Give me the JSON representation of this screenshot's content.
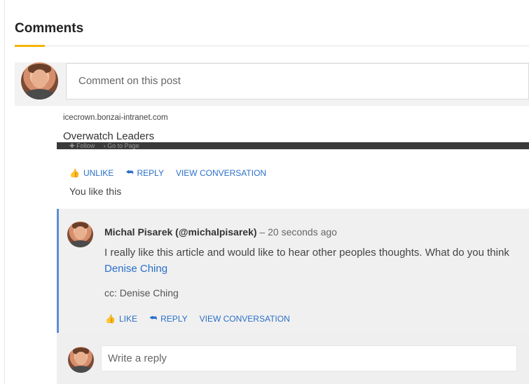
{
  "section": {
    "title": "Comments",
    "accent_color": "#f4b400"
  },
  "composer": {
    "placeholder": "Comment on this post",
    "avatar_icon": "user-avatar"
  },
  "link_preview": {
    "domain": "icecrown.bonzai-intranet.com",
    "title": "Overwatch Leaders",
    "follow_label": "Follow",
    "go_to_page_label": "Go to Page"
  },
  "post_actions": {
    "unlike_label": "UNLIKE",
    "reply_label": "REPLY",
    "view_conversation_label": "VIEW CONVERSATION",
    "like_status": "You like this",
    "link_color": "#2a6fc9"
  },
  "reply": {
    "author": "Michal Pisarek (@michalpisarek)",
    "separator": "–",
    "time": "20 seconds ago",
    "text": "I really like this article and would like to hear other peoples thoughts. What do you think",
    "mention": "Denise Ching",
    "cc": "cc: Denise Ching",
    "like_label": "LIKE",
    "reply_label": "REPLY",
    "view_conversation_label": "VIEW CONVERSATION",
    "border_color": "#5b8fd8"
  },
  "reply_composer": {
    "placeholder": "Write a reply"
  }
}
